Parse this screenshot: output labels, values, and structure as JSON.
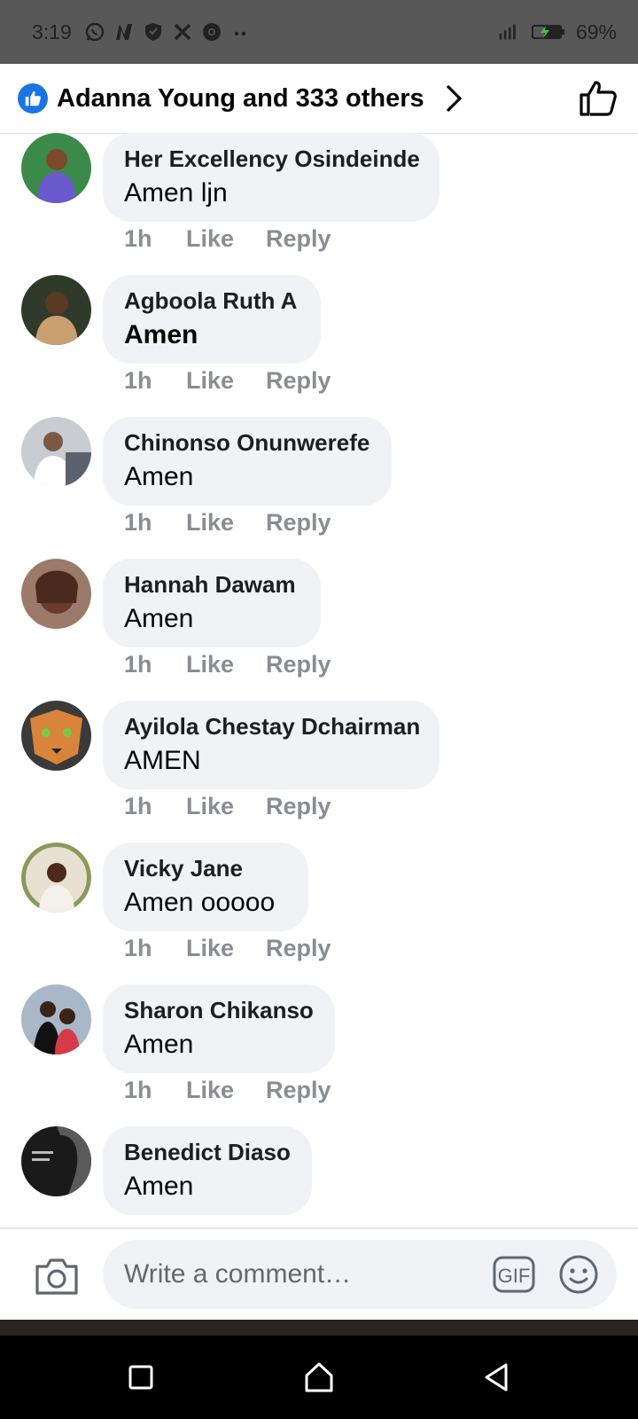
{
  "status_bar": {
    "time": "3:19",
    "icons": [
      "whatsapp-icon",
      "n-app-icon",
      "shield-icon",
      "x-icon",
      "chrome-icon",
      "more-dots-icon"
    ],
    "battery_percent": "69%"
  },
  "header": {
    "title": "Adanna Young and 333 others"
  },
  "comments": [
    {
      "name": "Her Excellency Osindeinde",
      "text": "Amen ljn",
      "time": "1h",
      "like": "Like",
      "reply": "Reply",
      "avatar_color": "#6a5acd"
    },
    {
      "name": "Agboola Ruth A",
      "text": "Amen",
      "time": "1h",
      "like": "Like",
      "reply": "Reply",
      "avatar_color": "#5a4a3a"
    },
    {
      "name": "Chinonso Onunwerefe",
      "text": "Amen",
      "time": "1h",
      "like": "Like",
      "reply": "Reply",
      "avatar_color": "#9aa0a6"
    },
    {
      "name": "Hannah Dawam",
      "text": "Amen",
      "time": "1h",
      "like": "Like",
      "reply": "Reply",
      "avatar_color": "#b08a78"
    },
    {
      "name": "Ayilola Chestay Dchairman",
      "text": "AMEN",
      "time": "1h",
      "like": "Like",
      "reply": "Reply",
      "avatar_color": "#c87a3a"
    },
    {
      "name": "Vicky Jane",
      "text": "Amen ooooo",
      "time": "1h",
      "like": "Like",
      "reply": "Reply",
      "avatar_color": "#c9a58a"
    },
    {
      "name": "Sharon Chikanso",
      "text": "Amen",
      "time": "1h",
      "like": "Like",
      "reply": "Reply",
      "avatar_color": "#3a4a6a"
    },
    {
      "name": "Benedict Diaso",
      "text": "Amen",
      "time": "",
      "like": "",
      "reply": "",
      "avatar_color": "#1a1a1a"
    }
  ],
  "composer": {
    "placeholder": "Write a comment…",
    "gif_label": "GIF"
  },
  "colors": {
    "accent": "#1b74e4",
    "bubble": "#f0f2f5",
    "meta_text": "#8a8d91"
  }
}
